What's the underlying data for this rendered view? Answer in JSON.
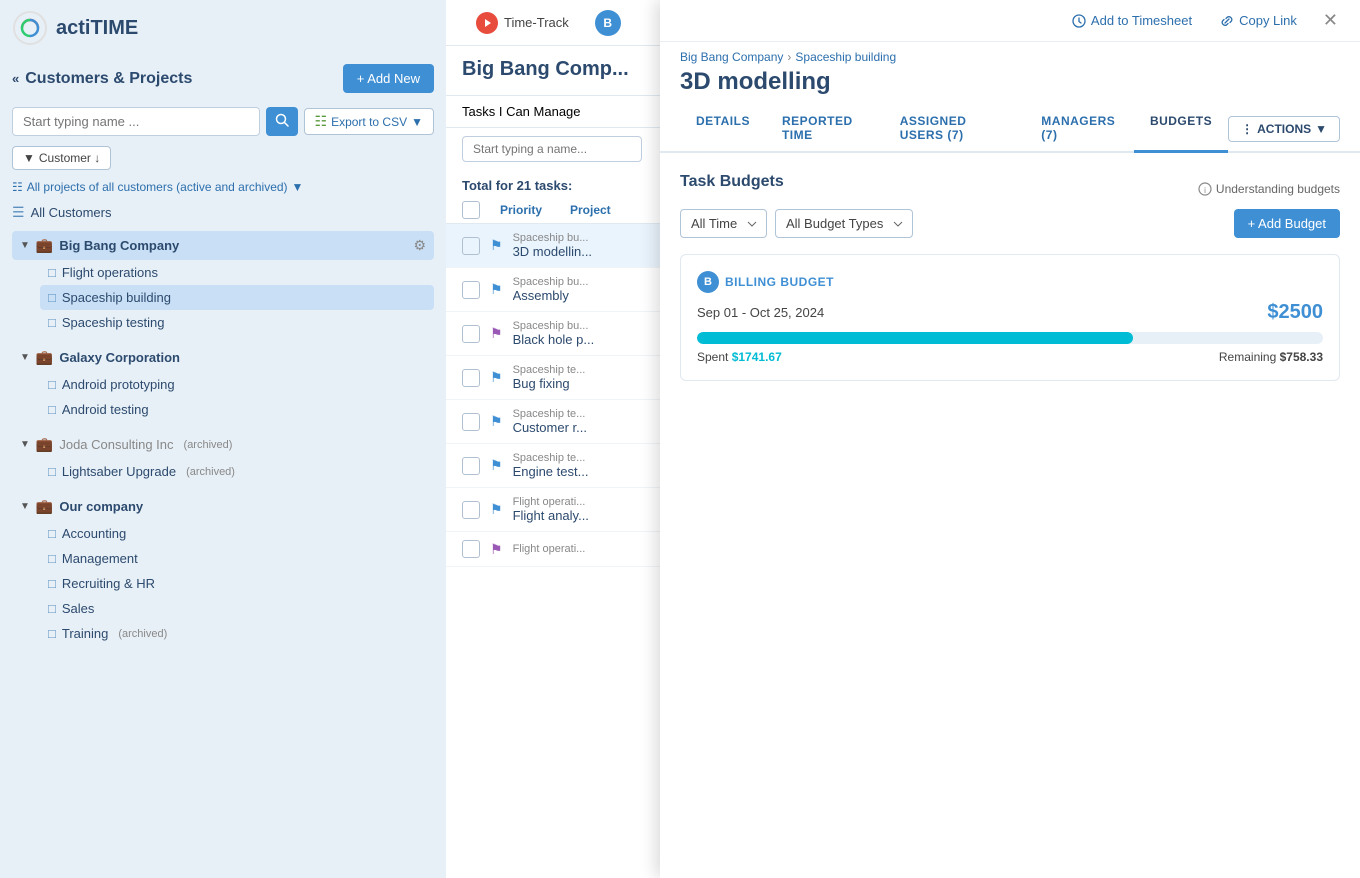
{
  "app": {
    "logo_text": "actiTIME",
    "nav": {
      "time_track_label": "Time-Track",
      "copy_link_label": "Copy Link",
      "add_to_timesheet_label": "Add to Timesheet"
    }
  },
  "sidebar": {
    "title": "Customers & Projects",
    "add_new_label": "+ Add New",
    "search_placeholder": "Start typing name ...",
    "export_btn_label": "Export to CSV",
    "customer_filter_label": "Customer ↓",
    "all_projects_filter_label": "All projects of all customers (active and archived)",
    "all_customers_label": "All Customers",
    "customers": [
      {
        "id": "big-bang",
        "name": "Big Bang Company",
        "expanded": true,
        "active": true,
        "projects": [
          {
            "id": "flight-ops",
            "name": "Flight operations"
          },
          {
            "id": "spaceship-build",
            "name": "Spaceship building",
            "active": true
          },
          {
            "id": "spaceship-test",
            "name": "Spaceship testing"
          }
        ]
      },
      {
        "id": "galaxy-corp",
        "name": "Galaxy Corporation",
        "expanded": true,
        "active": false,
        "projects": [
          {
            "id": "android-proto",
            "name": "Android prototyping"
          },
          {
            "id": "android-test",
            "name": "Android testing"
          }
        ]
      },
      {
        "id": "joda",
        "name": "Joda Consulting Inc",
        "archived": true,
        "expanded": true,
        "active": false,
        "projects": [
          {
            "id": "lightsaber",
            "name": "Lightsaber Upgrade",
            "archived": true
          }
        ]
      },
      {
        "id": "our-company",
        "name": "Our company",
        "expanded": true,
        "active": false,
        "projects": [
          {
            "id": "accounting",
            "name": "Accounting"
          },
          {
            "id": "management",
            "name": "Management"
          },
          {
            "id": "recruiting",
            "name": "Recruiting & HR"
          },
          {
            "id": "sales",
            "name": "Sales"
          },
          {
            "id": "training",
            "name": "Training",
            "archived": true
          }
        ]
      }
    ]
  },
  "main": {
    "title": "Big Bang Comp...",
    "tasks_filter_placeholder": "Start typing a name...",
    "tasks_total_label": "Total for 21 tasks:",
    "col_priority": "Priority",
    "col_project": "Project",
    "tasks": [
      {
        "project": "Spaceship bu...",
        "name": "3D modellin...",
        "flag": "blue",
        "active": true
      },
      {
        "project": "Spaceship bu...",
        "name": "Assembly",
        "flag": "blue"
      },
      {
        "project": "Spaceship bu...",
        "name": "Black hole p...",
        "flag": "purple"
      },
      {
        "project": "Spaceship te...",
        "name": "Bug fixing",
        "flag": "blue"
      },
      {
        "project": "Spaceship te...",
        "name": "Customer r...",
        "flag": "blue"
      },
      {
        "project": "Spaceship te...",
        "name": "Engine test...",
        "flag": "blue"
      },
      {
        "project": "Flight operati...",
        "name": "Flight analy...",
        "flag": "blue"
      },
      {
        "project": "Flight operati...",
        "name": "...",
        "flag": "purple"
      }
    ],
    "tasks_i_can_manage_label": "Tasks I Can Manage"
  },
  "detail": {
    "breadcrumb_company": "Big Bang Company",
    "breadcrumb_project": "Spaceship building",
    "title": "3D modelling",
    "tabs": [
      {
        "id": "details",
        "label": "DETAILS"
      },
      {
        "id": "reported-time",
        "label": "REPORTED TIME"
      },
      {
        "id": "assigned-users",
        "label": "ASSIGNED USERS (7)"
      },
      {
        "id": "managers",
        "label": "MANAGERS (7)"
      },
      {
        "id": "budgets",
        "label": "BUDGETS",
        "active": true
      }
    ],
    "actions_label": "ACTIONS",
    "budget_section_title": "Task Budgets",
    "understanding_budgets_label": "Understanding budgets",
    "all_time_select": "All Time",
    "all_budget_types_select": "All Budget Types",
    "add_budget_label": "+ Add Budget",
    "budget": {
      "type": "BILLING BUDGET",
      "type_initial": "B",
      "date_range": "Sep 01 - Oct 25, 2024",
      "amount": "$2500",
      "progress_pct": 69.67,
      "spent_label": "Spent",
      "spent_value": "$1741.67",
      "remaining_label": "Remaining",
      "remaining_value": "$758.33"
    }
  }
}
